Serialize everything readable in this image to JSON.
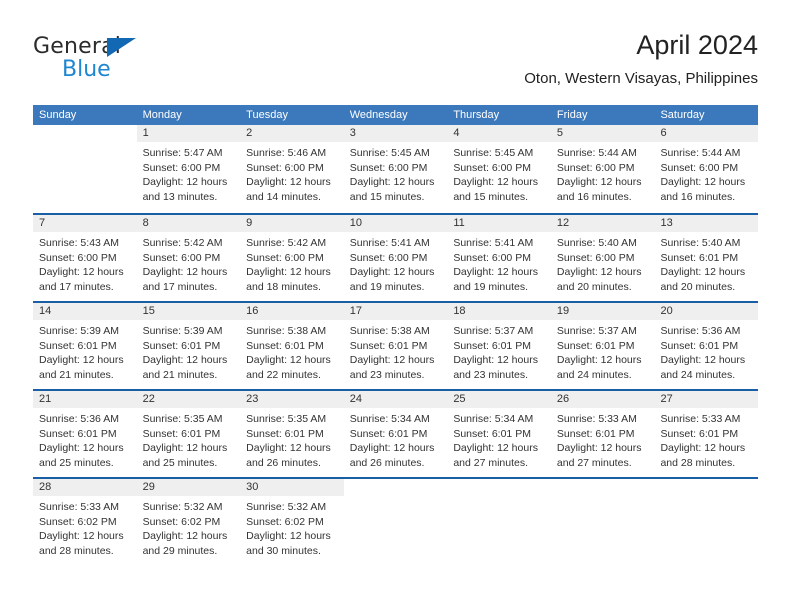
{
  "brand": {
    "name_part1": "General",
    "name_part2": "Blue",
    "triangle_icon": "triangle-icon",
    "accent_color": "#1f86d0"
  },
  "header": {
    "month_title": "April 2024",
    "location": "Oton, Western Visayas, Philippines"
  },
  "calendar": {
    "header_bg": "#3b79bc",
    "row_divider_color": "#1a5fa4",
    "daynum_bg": "#efefef",
    "weekdays": [
      "Sunday",
      "Monday",
      "Tuesday",
      "Wednesday",
      "Thursday",
      "Friday",
      "Saturday"
    ],
    "weeks": [
      [
        {
          "day": "",
          "empty": true
        },
        {
          "day": "1",
          "sunrise": "Sunrise: 5:47 AM",
          "sunset": "Sunset: 6:00 PM",
          "daylight_1": "Daylight: 12 hours",
          "daylight_2": "and 13 minutes."
        },
        {
          "day": "2",
          "sunrise": "Sunrise: 5:46 AM",
          "sunset": "Sunset: 6:00 PM",
          "daylight_1": "Daylight: 12 hours",
          "daylight_2": "and 14 minutes."
        },
        {
          "day": "3",
          "sunrise": "Sunrise: 5:45 AM",
          "sunset": "Sunset: 6:00 PM",
          "daylight_1": "Daylight: 12 hours",
          "daylight_2": "and 15 minutes."
        },
        {
          "day": "4",
          "sunrise": "Sunrise: 5:45 AM",
          "sunset": "Sunset: 6:00 PM",
          "daylight_1": "Daylight: 12 hours",
          "daylight_2": "and 15 minutes."
        },
        {
          "day": "5",
          "sunrise": "Sunrise: 5:44 AM",
          "sunset": "Sunset: 6:00 PM",
          "daylight_1": "Daylight: 12 hours",
          "daylight_2": "and 16 minutes."
        },
        {
          "day": "6",
          "sunrise": "Sunrise: 5:44 AM",
          "sunset": "Sunset: 6:00 PM",
          "daylight_1": "Daylight: 12 hours",
          "daylight_2": "and 16 minutes."
        }
      ],
      [
        {
          "day": "7",
          "sunrise": "Sunrise: 5:43 AM",
          "sunset": "Sunset: 6:00 PM",
          "daylight_1": "Daylight: 12 hours",
          "daylight_2": "and 17 minutes."
        },
        {
          "day": "8",
          "sunrise": "Sunrise: 5:42 AM",
          "sunset": "Sunset: 6:00 PM",
          "daylight_1": "Daylight: 12 hours",
          "daylight_2": "and 17 minutes."
        },
        {
          "day": "9",
          "sunrise": "Sunrise: 5:42 AM",
          "sunset": "Sunset: 6:00 PM",
          "daylight_1": "Daylight: 12 hours",
          "daylight_2": "and 18 minutes."
        },
        {
          "day": "10",
          "sunrise": "Sunrise: 5:41 AM",
          "sunset": "Sunset: 6:00 PM",
          "daylight_1": "Daylight: 12 hours",
          "daylight_2": "and 19 minutes."
        },
        {
          "day": "11",
          "sunrise": "Sunrise: 5:41 AM",
          "sunset": "Sunset: 6:00 PM",
          "daylight_1": "Daylight: 12 hours",
          "daylight_2": "and 19 minutes."
        },
        {
          "day": "12",
          "sunrise": "Sunrise: 5:40 AM",
          "sunset": "Sunset: 6:00 PM",
          "daylight_1": "Daylight: 12 hours",
          "daylight_2": "and 20 minutes."
        },
        {
          "day": "13",
          "sunrise": "Sunrise: 5:40 AM",
          "sunset": "Sunset: 6:01 PM",
          "daylight_1": "Daylight: 12 hours",
          "daylight_2": "and 20 minutes."
        }
      ],
      [
        {
          "day": "14",
          "sunrise": "Sunrise: 5:39 AM",
          "sunset": "Sunset: 6:01 PM",
          "daylight_1": "Daylight: 12 hours",
          "daylight_2": "and 21 minutes."
        },
        {
          "day": "15",
          "sunrise": "Sunrise: 5:39 AM",
          "sunset": "Sunset: 6:01 PM",
          "daylight_1": "Daylight: 12 hours",
          "daylight_2": "and 21 minutes."
        },
        {
          "day": "16",
          "sunrise": "Sunrise: 5:38 AM",
          "sunset": "Sunset: 6:01 PM",
          "daylight_1": "Daylight: 12 hours",
          "daylight_2": "and 22 minutes."
        },
        {
          "day": "17",
          "sunrise": "Sunrise: 5:38 AM",
          "sunset": "Sunset: 6:01 PM",
          "daylight_1": "Daylight: 12 hours",
          "daylight_2": "and 23 minutes."
        },
        {
          "day": "18",
          "sunrise": "Sunrise: 5:37 AM",
          "sunset": "Sunset: 6:01 PM",
          "daylight_1": "Daylight: 12 hours",
          "daylight_2": "and 23 minutes."
        },
        {
          "day": "19",
          "sunrise": "Sunrise: 5:37 AM",
          "sunset": "Sunset: 6:01 PM",
          "daylight_1": "Daylight: 12 hours",
          "daylight_2": "and 24 minutes."
        },
        {
          "day": "20",
          "sunrise": "Sunrise: 5:36 AM",
          "sunset": "Sunset: 6:01 PM",
          "daylight_1": "Daylight: 12 hours",
          "daylight_2": "and 24 minutes."
        }
      ],
      [
        {
          "day": "21",
          "sunrise": "Sunrise: 5:36 AM",
          "sunset": "Sunset: 6:01 PM",
          "daylight_1": "Daylight: 12 hours",
          "daylight_2": "and 25 minutes."
        },
        {
          "day": "22",
          "sunrise": "Sunrise: 5:35 AM",
          "sunset": "Sunset: 6:01 PM",
          "daylight_1": "Daylight: 12 hours",
          "daylight_2": "and 25 minutes."
        },
        {
          "day": "23",
          "sunrise": "Sunrise: 5:35 AM",
          "sunset": "Sunset: 6:01 PM",
          "daylight_1": "Daylight: 12 hours",
          "daylight_2": "and 26 minutes."
        },
        {
          "day": "24",
          "sunrise": "Sunrise: 5:34 AM",
          "sunset": "Sunset: 6:01 PM",
          "daylight_1": "Daylight: 12 hours",
          "daylight_2": "and 26 minutes."
        },
        {
          "day": "25",
          "sunrise": "Sunrise: 5:34 AM",
          "sunset": "Sunset: 6:01 PM",
          "daylight_1": "Daylight: 12 hours",
          "daylight_2": "and 27 minutes."
        },
        {
          "day": "26",
          "sunrise": "Sunrise: 5:33 AM",
          "sunset": "Sunset: 6:01 PM",
          "daylight_1": "Daylight: 12 hours",
          "daylight_2": "and 27 minutes."
        },
        {
          "day": "27",
          "sunrise": "Sunrise: 5:33 AM",
          "sunset": "Sunset: 6:01 PM",
          "daylight_1": "Daylight: 12 hours",
          "daylight_2": "and 28 minutes."
        }
      ],
      [
        {
          "day": "28",
          "sunrise": "Sunrise: 5:33 AM",
          "sunset": "Sunset: 6:02 PM",
          "daylight_1": "Daylight: 12 hours",
          "daylight_2": "and 28 minutes."
        },
        {
          "day": "29",
          "sunrise": "Sunrise: 5:32 AM",
          "sunset": "Sunset: 6:02 PM",
          "daylight_1": "Daylight: 12 hours",
          "daylight_2": "and 29 minutes."
        },
        {
          "day": "30",
          "sunrise": "Sunrise: 5:32 AM",
          "sunset": "Sunset: 6:02 PM",
          "daylight_1": "Daylight: 12 hours",
          "daylight_2": "and 30 minutes."
        },
        {
          "day": "",
          "empty": true
        },
        {
          "day": "",
          "empty": true
        },
        {
          "day": "",
          "empty": true
        },
        {
          "day": "",
          "empty": true
        }
      ]
    ]
  }
}
